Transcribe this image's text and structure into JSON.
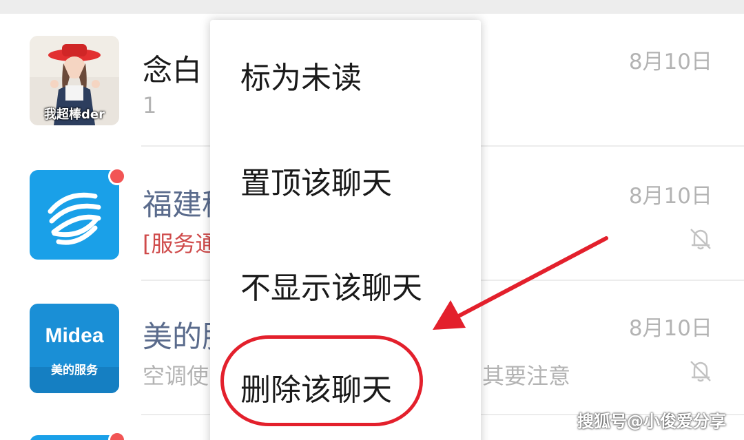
{
  "chats": [
    {
      "name": "念白",
      "preview": "1",
      "time": "8月10日",
      "avatar_caption": "我超棒der"
    },
    {
      "name": "福建移",
      "preview_tag": "[服务通",
      "preview": "",
      "time": "8月10日",
      "muted": true,
      "unread_dot": true
    },
    {
      "name": "美的服",
      "preview": "空调使",
      "preview_tail": "其要注意",
      "time": "8月10日",
      "muted": true,
      "avatar_brand": "Midea",
      "avatar_caption": "美的服务"
    }
  ],
  "context_menu": {
    "items": [
      {
        "label": "标为未读"
      },
      {
        "label": "置顶该聊天"
      },
      {
        "label": "不显示该聊天"
      },
      {
        "label": "删除该聊天"
      }
    ]
  },
  "watermark": "搜狐号@小俊爱分享",
  "colors": {
    "annotation_red": "#e3202c",
    "unread_dot": "#f25555",
    "official_name": "#5a6b8c",
    "mobile_blue": "#1aa0e8",
    "midea_blue": "#1a8fd6"
  }
}
